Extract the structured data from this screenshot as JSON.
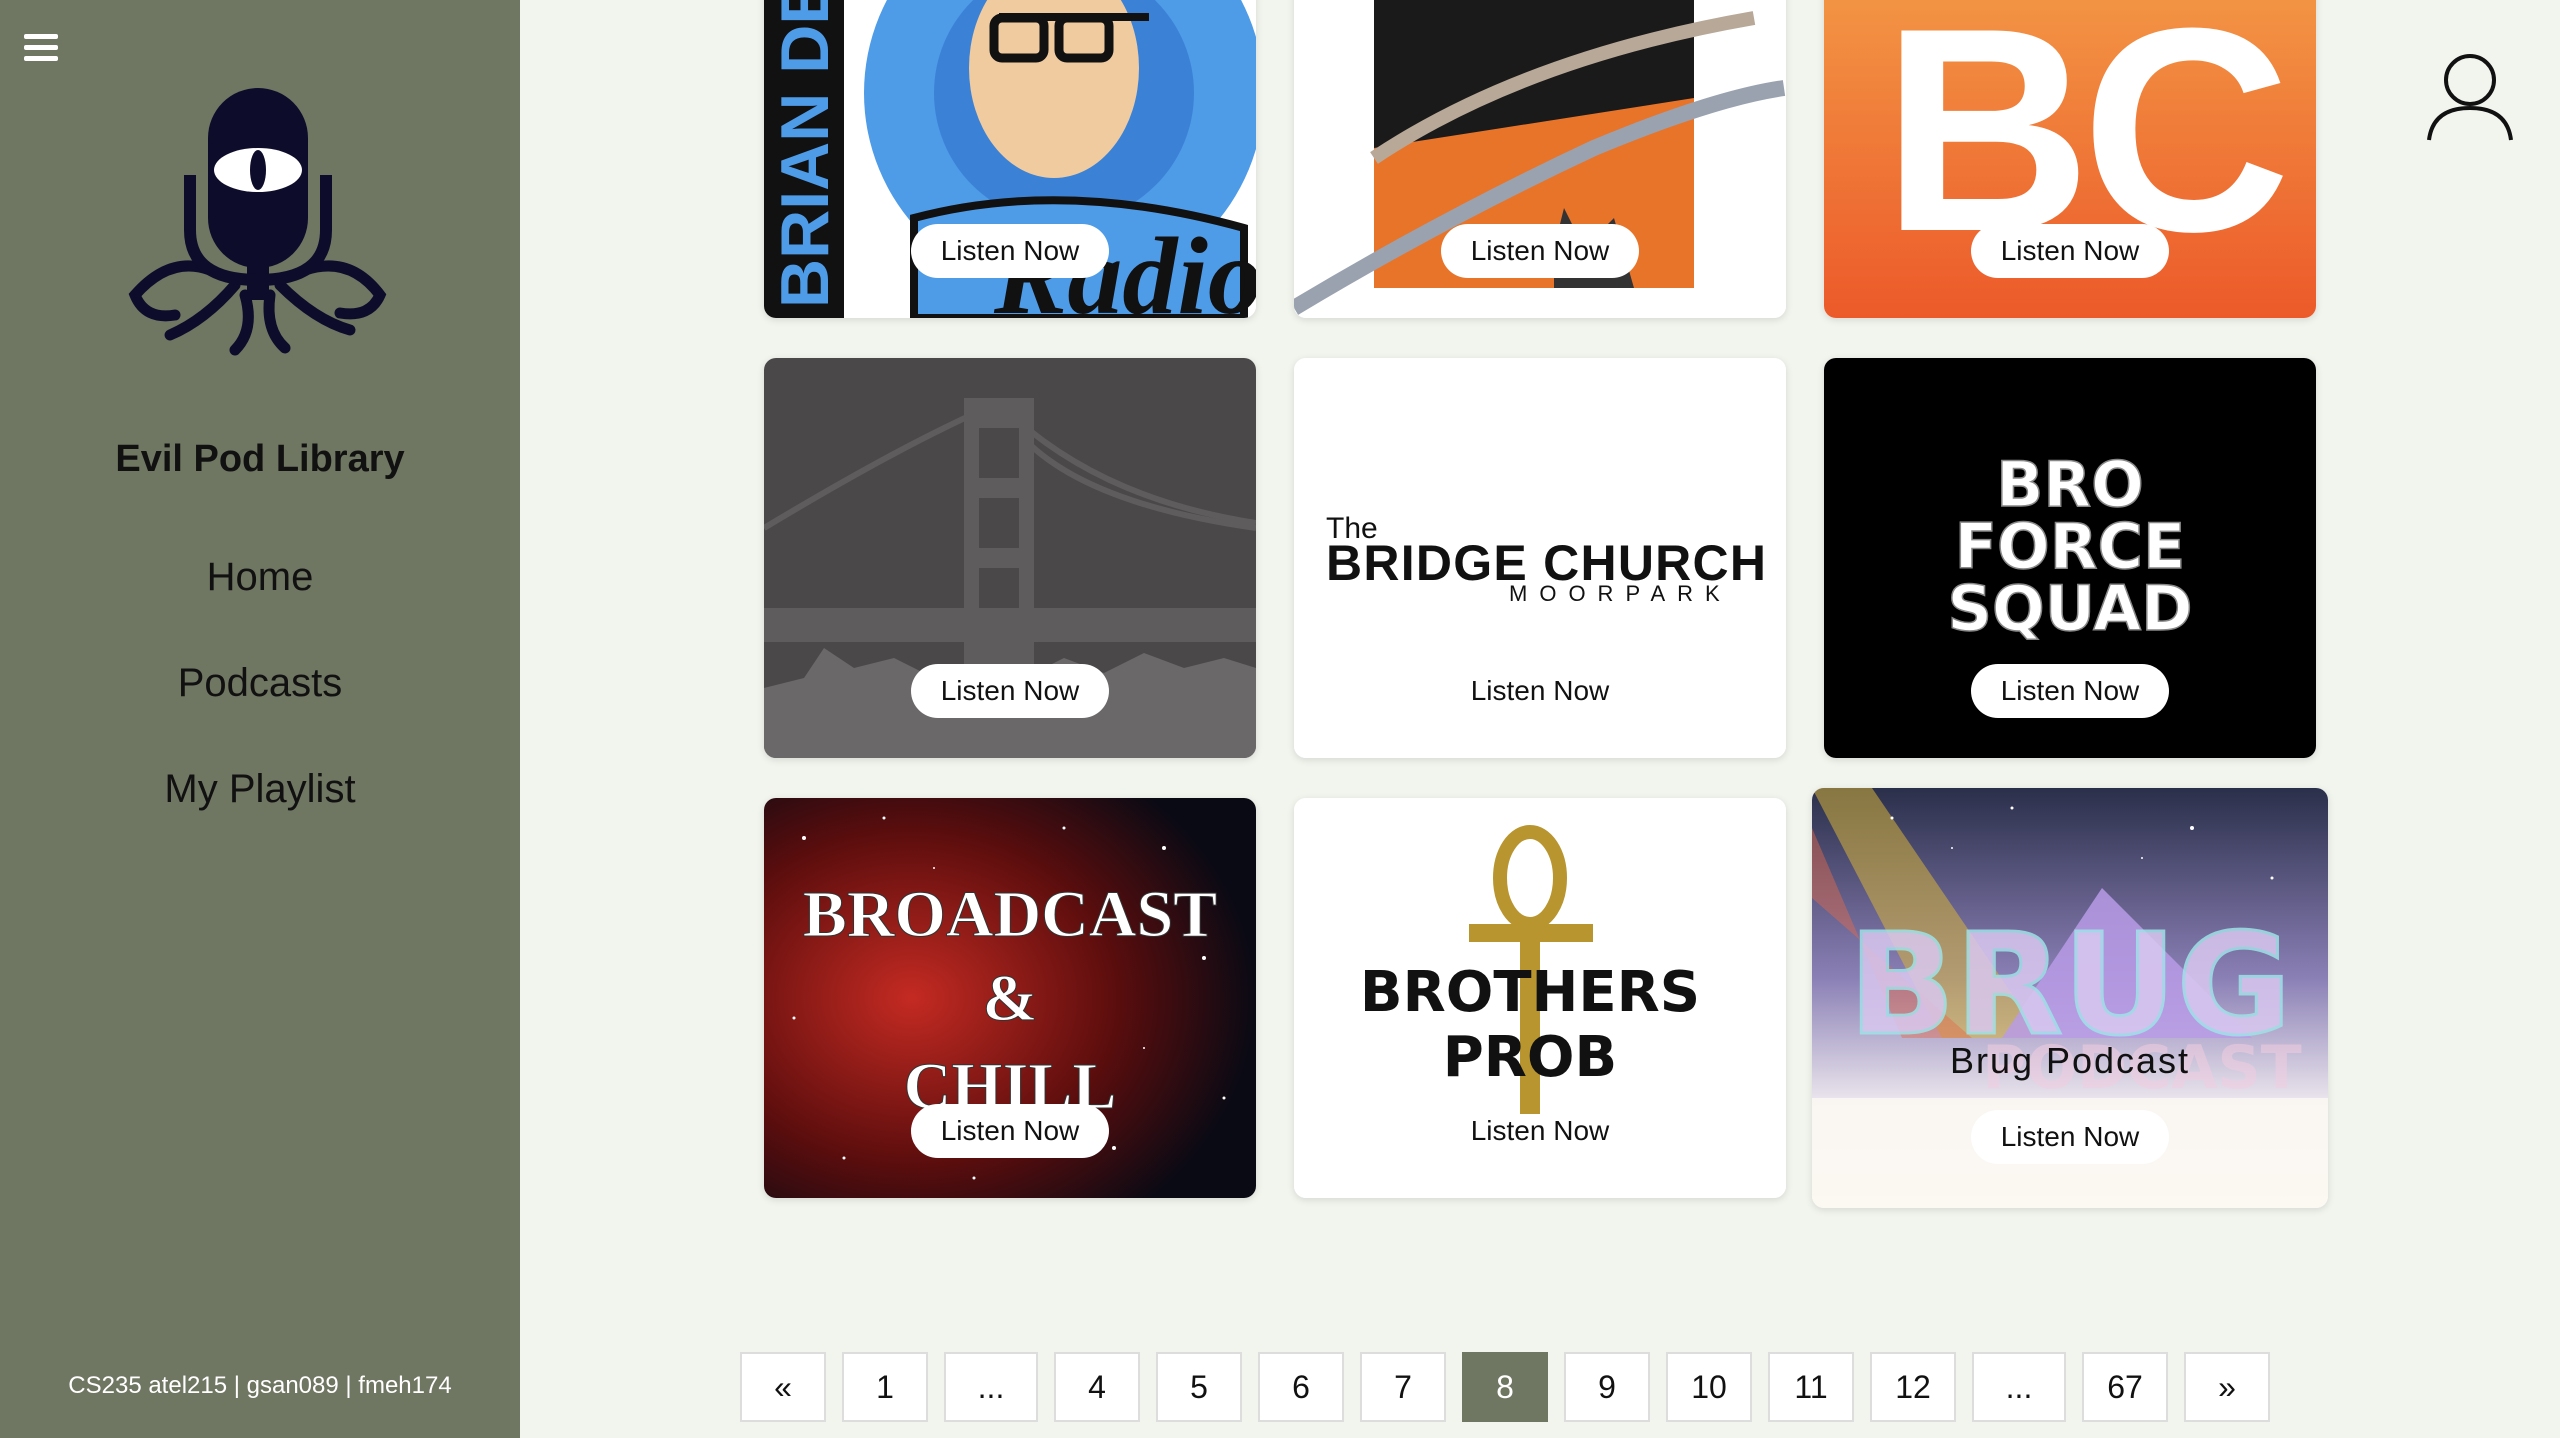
{
  "sidebar": {
    "brand": "Evil Pod Library",
    "nav": [
      "Home",
      "Podcasts",
      "My Playlist"
    ],
    "credits": "CS235 atel215 | gsan089 | fmeh174"
  },
  "cards": [
    {
      "art_text": "BRIAN DEN",
      "art_script": "Radio",
      "button": "Listen Now"
    },
    {
      "button": "Listen Now"
    },
    {
      "art_text": "BC",
      "button": "Listen Now"
    },
    {
      "button": "Listen Now"
    },
    {
      "art_small": "The",
      "art_text": "BRIDGE CHURCH",
      "art_sub": "MOORPARK",
      "button": "Listen Now"
    },
    {
      "art_lines": [
        "BRO",
        "FORCE",
        "SQUAD"
      ],
      "button": "Listen Now"
    },
    {
      "art_lines": [
        "BROADCAST",
        "&",
        "CHILL"
      ],
      "button": "Listen Now"
    },
    {
      "art_lines": [
        "BROTHERS",
        "PROB"
      ],
      "button": "Listen Now"
    },
    {
      "art_text": "BRUG",
      "art_sub": "PODCAST",
      "title": "Brug Podcast",
      "button": "Listen Now"
    }
  ],
  "pagination": {
    "pages": [
      "«",
      "1",
      "...",
      "4",
      "5",
      "6",
      "7",
      "8",
      "9",
      "10",
      "11",
      "12",
      "...",
      "67",
      "»"
    ],
    "current": "8"
  },
  "colors": {
    "sidebar": "#6f7662",
    "background": "#f2f5ee",
    "active_page": "#6f7662"
  },
  "icons": [
    "hamburger-icon",
    "podcast-monster-logo",
    "user-profile-icon"
  ]
}
